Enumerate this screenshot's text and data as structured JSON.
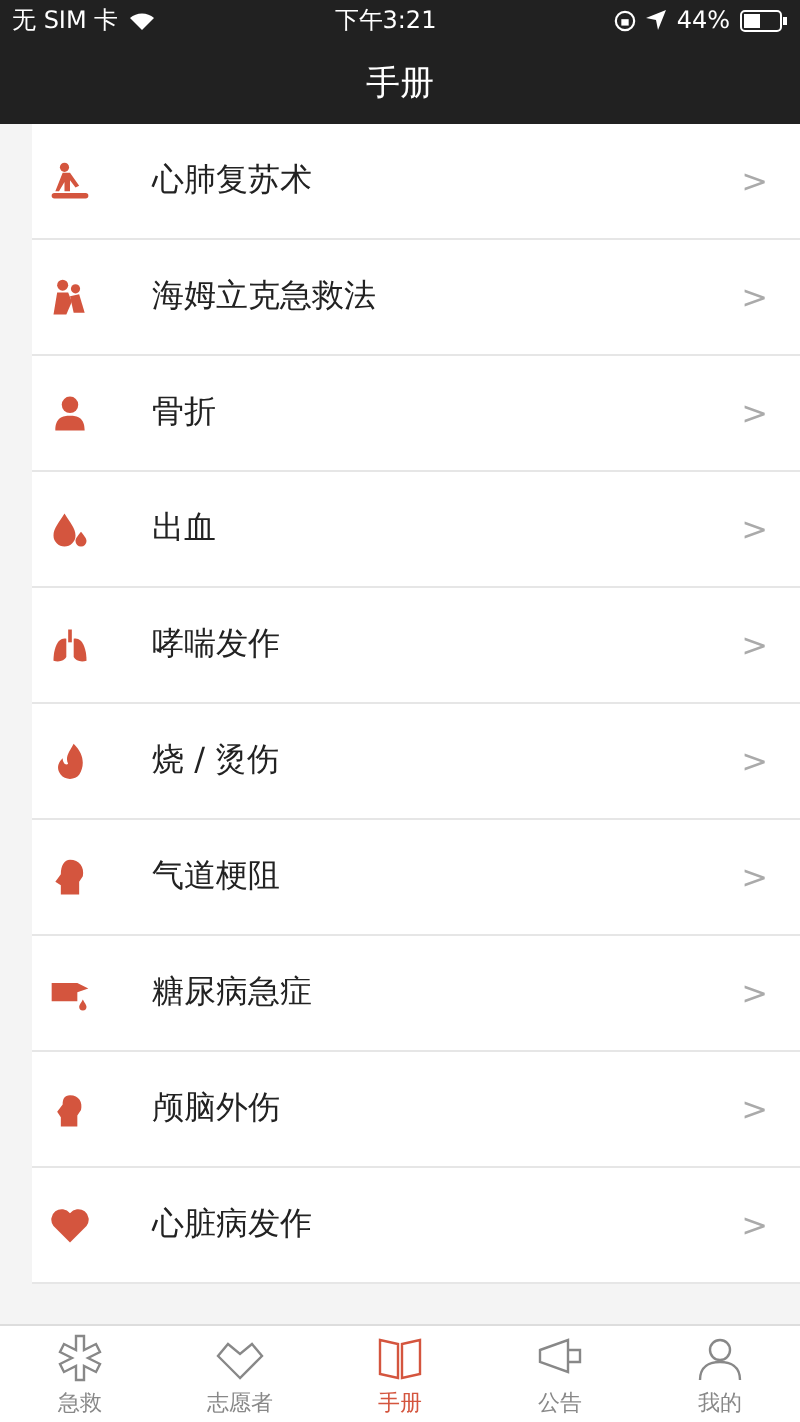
{
  "status_bar": {
    "carrier": "无 SIM 卡",
    "time": "下午3:21",
    "battery": "44%"
  },
  "nav_bar": {
    "title": "手册"
  },
  "items": [
    {
      "label": "心肺复苏术",
      "chevron": ">"
    },
    {
      "label": "海姆立克急救法",
      "chevron": ">"
    },
    {
      "label": "骨折",
      "chevron": ">"
    },
    {
      "label": "出血",
      "chevron": ">"
    },
    {
      "label": "哮喘发作",
      "chevron": ">"
    },
    {
      "label": "烧 / 烫伤",
      "chevron": ">"
    },
    {
      "label": "气道梗阻",
      "chevron": ">"
    },
    {
      "label": "糖尿病急症",
      "chevron": ">"
    },
    {
      "label": "颅脑外伤",
      "chevron": ">"
    },
    {
      "label": "心脏病发作",
      "chevron": ">"
    }
  ],
  "tab_bar": [
    {
      "label": "急救",
      "selected": false
    },
    {
      "label": "志愿者",
      "selected": false
    },
    {
      "label": "手册",
      "selected": true
    },
    {
      "label": "公告",
      "selected": false
    },
    {
      "label": "我的",
      "selected": false
    }
  ]
}
